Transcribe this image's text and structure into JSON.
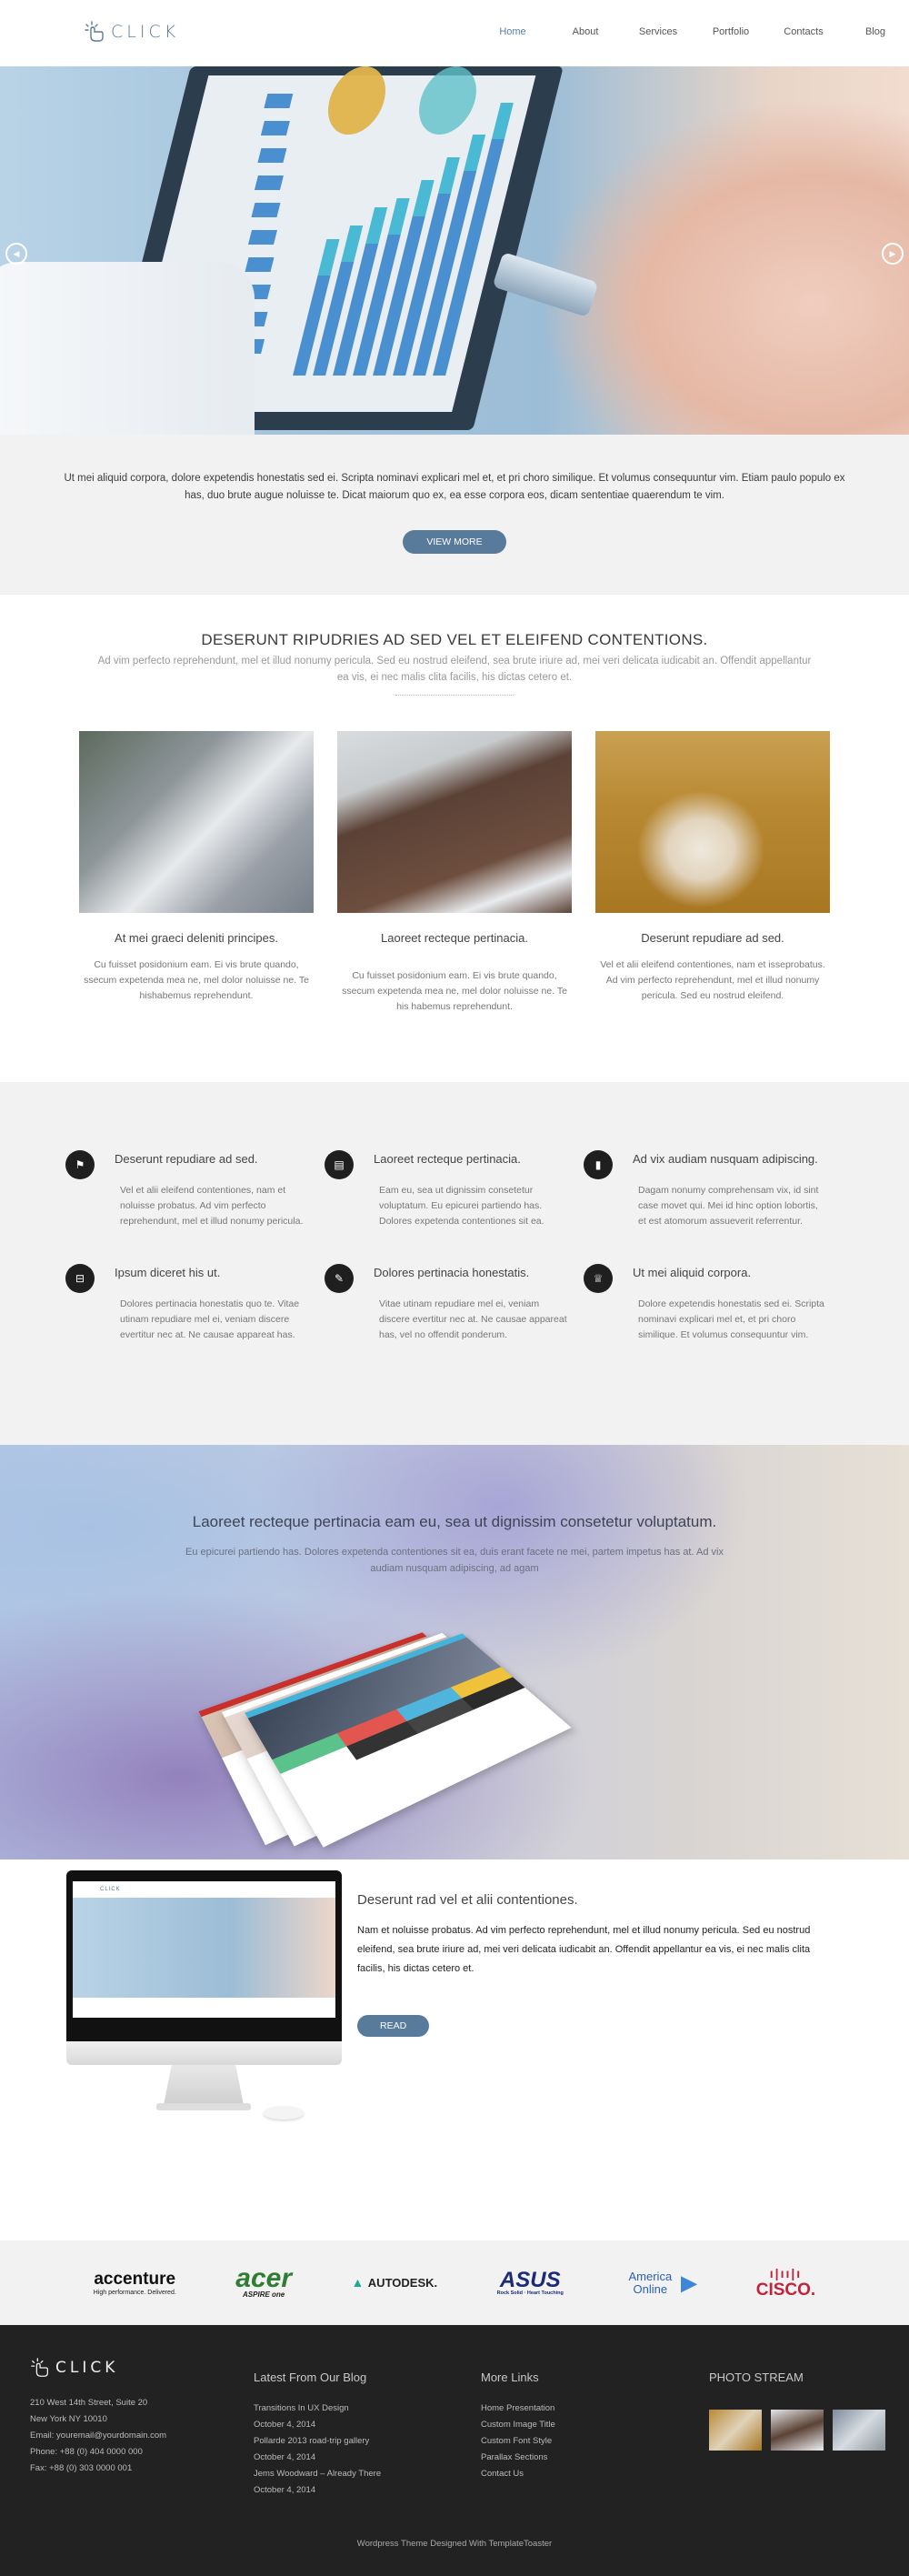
{
  "header": {
    "logo_text": "CLICK",
    "nav": [
      {
        "label": "Home",
        "active": true
      },
      {
        "label": "About",
        "active": false
      },
      {
        "label": "Services",
        "active": false
      },
      {
        "label": "Portfolio",
        "active": false
      },
      {
        "label": "Contacts",
        "active": false
      },
      {
        "label": "Blog",
        "active": false
      }
    ]
  },
  "hero": {
    "prev_icon": "chevron-left-circle",
    "next_icon": "chevron-right-circle"
  },
  "intro": {
    "text": "Ut mei aliquid corpora, dolore expetendis honestatis sed ei. Scripta nominavi explicari mel et, et pri choro similique. Et volumus consequuntur vim. Etiam paulo populo ex has, duo brute augue noluisse te. Dicat maiorum quo ex, ea esse corpora eos, dicam sententiae quaerendum te vim.",
    "button": "VIEW MORE"
  },
  "features": {
    "title": "DESERUNT RIPUDRIES AD SED VEL ET ELEIFEND CONTENTIONS.",
    "subtitle": "Ad vim perfecto reprehendunt, mel et illud nonumy pericula. Sed eu nostrud eleifend, sea brute iriure ad, mei veri delicata iudicabit an. Offendit appellantur ea vis, ei nec malis clita facilis, his dictas cetero et.",
    "cards": [
      {
        "title": "At mei graeci deleniti principes.",
        "text": "Cu fuisset posidonium eam. Ei vis brute quando, ssecum expetenda mea ne, mel dolor noluisse ne. Te hishabemus reprehendunt."
      },
      {
        "title": "Laoreet recteque pertinacia.",
        "text": "Cu fuisset posidonium eam. Ei vis brute quando, ssecum expetenda mea ne, mel dolor noluisse ne. Te his habemus reprehendunt."
      },
      {
        "title": "Deserunt repudiare ad sed.",
        "text": "Vel et alii eleifend contentiones, nam et isseprobatus. Ad vim perfecto reprehendunt, mel et illud nonumy pericula. Sed eu nostrud eleifend."
      }
    ]
  },
  "services": [
    {
      "icon": "flag",
      "glyph": "⚑",
      "title": "Deserunt repudiare ad sed.",
      "text": "Vel et alii eleifend contentiones, nam et noluisse probatus. Ad vim perfecto reprehendunt, mel et illud nonumy pericula."
    },
    {
      "icon": "book",
      "glyph": "▤",
      "title": "Laoreet recteque pertinacia.",
      "text": "Eam eu, sea ut dignissim consetetur voluptatum. Eu epicurei partiendo has. Dolores expetenda contentiones sit ea."
    },
    {
      "icon": "briefcase",
      "glyph": "▮",
      "title": "Ad vix audiam nusquam adipiscing.",
      "text": "Dagam nonumy comprehensam vix, id sint case movet qui. Mei id hinc option lobortis, et est atomorum assueverit referrentur."
    },
    {
      "icon": "inbox",
      "glyph": "⊟",
      "title": "Ipsum diceret his ut.",
      "text": "Dolores pertinacia honestatis quo te. Vitae utinam repudiare mel ei, veniam discere evertitur nec at. Ne causae appareat has."
    },
    {
      "icon": "pencil",
      "glyph": "✎",
      "title": "Dolores pertinacia honestatis.",
      "text": "Vitae utinam repudiare mel ei, veniam discere evertitur nec at. Ne causae appareat has, vel no offendit ponderum."
    },
    {
      "icon": "trophy",
      "glyph": "♕",
      "title": "Ut mei aliquid corpora.",
      "text": "Dolore expetendis honestatis sed ei. Scripta nominavi explicari mel et, et pri choro similique. Et volumus consequuntur vim."
    }
  ],
  "parallax": {
    "title": "Laoreet recteque pertinacia eam eu, sea ut dignissim consetetur voluptatum.",
    "text": "Eu epicurei partiendo has. Dolores expetenda contentiones sit ea, duis erant facete ne mei, partem impetus has at. Ad vix audiam nusquam adipiscing, ad agam"
  },
  "showcase": {
    "title": "Deserunt rad vel et alii contentiones.",
    "text": "Nam et noluisse probatus. Ad vim perfecto reprehendunt, mel et illud nonumy pericula. Sed eu nostrud eleifend, sea brute iriure ad, mei veri delicata iudicabit an. Offendit appellantur ea vis, ei nec malis clita facilis, his dictas cetero et.",
    "button": "READ",
    "mini_logo": "CLICK"
  },
  "clients": [
    {
      "name": "accenture",
      "tagline": "High performance. Delivered.",
      "color": "#111111"
    },
    {
      "name": "acer",
      "tagline": "ASPIRE one",
      "color": "#2e7d32"
    },
    {
      "name": "AUTODESK.",
      "tagline": "",
      "color": "#222222"
    },
    {
      "name": "ASUS",
      "tagline": "Rock Solid · Heart Touching",
      "color": "#1c2a7a"
    },
    {
      "name": "America Online",
      "tagline": "",
      "color": "#2b5fb0"
    },
    {
      "name": "CISCO.",
      "tagline": "",
      "color": "#c0243a"
    }
  ],
  "footer": {
    "logo_text": "CLICK",
    "address": [
      "210 West 14th Street, Suite 20",
      "New York NY 10010",
      "Email: youremail@yourdomain.com",
      "Phone: +88 (0) 404 0000 000",
      "Fax: +88 (0) 303 0000 001"
    ],
    "blog_title": "Latest From Our Blog",
    "blog": [
      {
        "title": "Transitions In UX Design",
        "date": "October 4, 2014"
      },
      {
        "title": "Pollarde 2013 road-trip gallery",
        "date": "October 4, 2014"
      },
      {
        "title": "Jems Woodward – Already There",
        "date": "October 4, 2014"
      }
    ],
    "links_title": "More Links",
    "links": [
      "Home Presentation",
      "Custom Image Title",
      "Custom Font Style",
      "Parallax Sections",
      "Contact Us"
    ],
    "photo_title": "PHOTO STREAM",
    "copyright": "Wordpress Theme Designed With TemplateToaster"
  }
}
